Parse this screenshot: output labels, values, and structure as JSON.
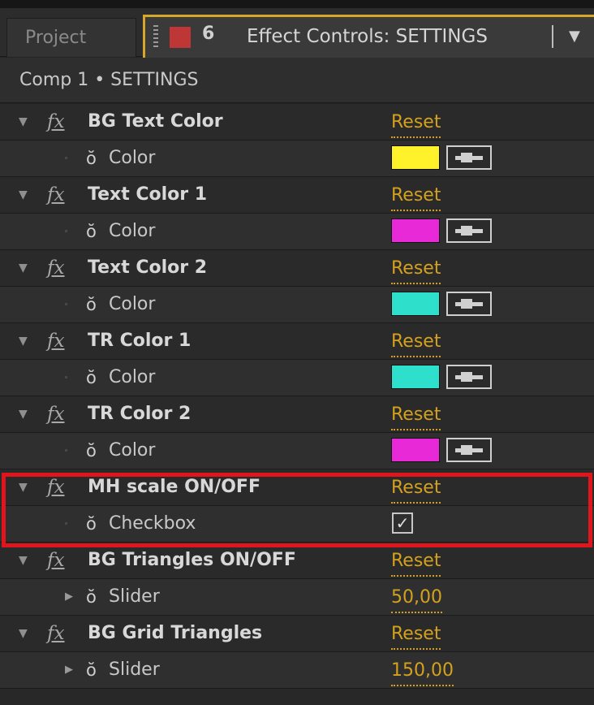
{
  "tabs": {
    "project": "Project",
    "lock_icon": "lock-icon",
    "label_color": "#bf3636",
    "effect_controls": "Effect Controls: SETTINGS",
    "menu_glyph": "▼"
  },
  "breadcrumb": "Comp 1 • SETTINGS",
  "glyphs": {
    "triangle_open": "▼",
    "triangle_closed": "▶",
    "fx": "fx",
    "stopwatch": "͡○",
    "check": "✓"
  },
  "accent_color": "#d4a11e",
  "highlight_color": "#e0161c",
  "effects": [
    {
      "name": "BG Text Color",
      "reset": "Reset",
      "param": {
        "name": "Color",
        "type": "color",
        "color": "#fff22a"
      }
    },
    {
      "name": "Text Color 1",
      "reset": "Reset",
      "param": {
        "name": "Color",
        "type": "color",
        "color": "#e829d8"
      }
    },
    {
      "name": "Text Color 2",
      "reset": "Reset",
      "param": {
        "name": "Color",
        "type": "color",
        "color": "#2ee0cc"
      }
    },
    {
      "name": "TR Color 1",
      "reset": "Reset",
      "param": {
        "name": "Color",
        "type": "color",
        "color": "#2ee0cc"
      }
    },
    {
      "name": "TR Color 2",
      "reset": "Reset",
      "param": {
        "name": "Color",
        "type": "color",
        "color": "#e829d8"
      }
    },
    {
      "name": "MH scale ON/OFF",
      "reset": "Reset",
      "param": {
        "name": "Checkbox",
        "type": "checkbox",
        "checked": true
      }
    },
    {
      "name": "BG Triangles ON/OFF",
      "reset": "Reset",
      "param": {
        "name": "Slider",
        "type": "slider",
        "value": "50,00"
      }
    },
    {
      "name": "BG Grid Triangles",
      "reset": "Reset",
      "param": {
        "name": "Slider",
        "type": "slider",
        "value": "150,00"
      }
    }
  ]
}
